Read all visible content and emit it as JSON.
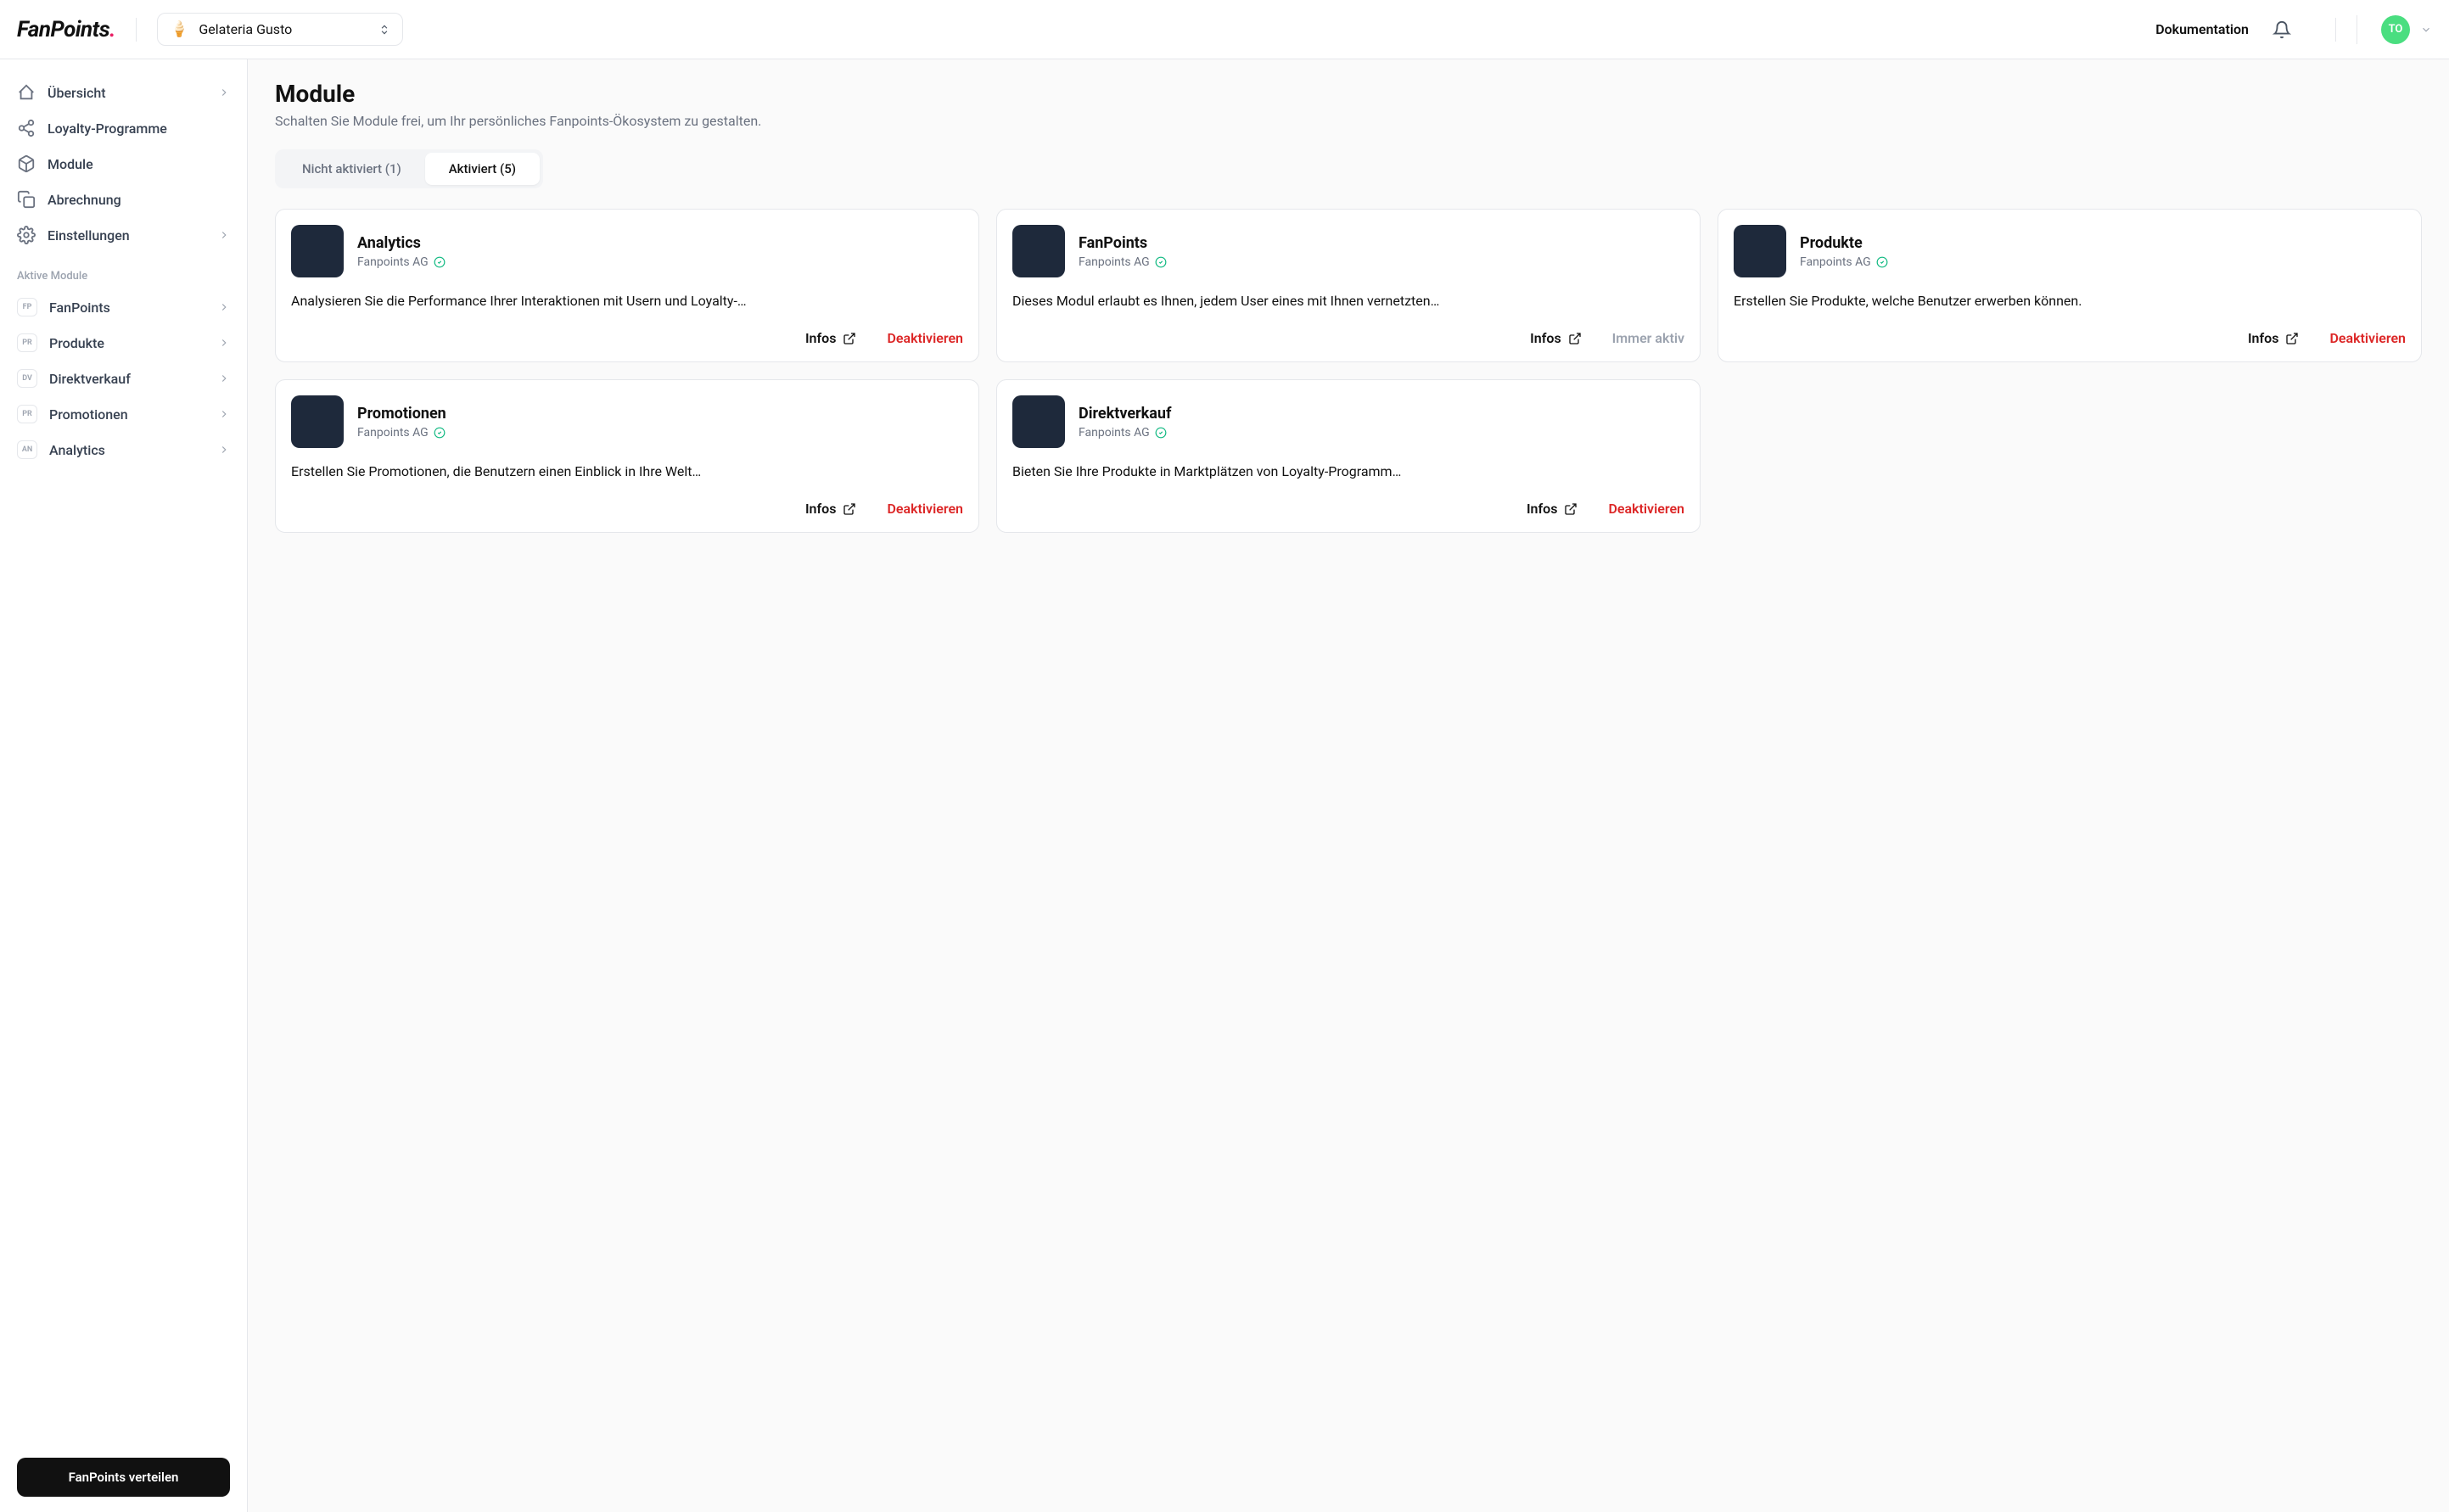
{
  "header": {
    "org_name": "Gelateria Gusto",
    "doc_link": "Dokumentation",
    "avatar_initials": "TO"
  },
  "sidebar": {
    "nav": [
      {
        "label": "Übersicht",
        "has_chevron": true,
        "icon": "home"
      },
      {
        "label": "Loyalty-Programme",
        "has_chevron": false,
        "icon": "share"
      },
      {
        "label": "Module",
        "has_chevron": false,
        "icon": "box"
      },
      {
        "label": "Abrechnung",
        "has_chevron": false,
        "icon": "copy"
      },
      {
        "label": "Einstellungen",
        "has_chevron": true,
        "icon": "gear"
      }
    ],
    "section_label": "Aktive Module",
    "modules": [
      {
        "abbr": "FP",
        "label": "FanPoints"
      },
      {
        "abbr": "PR",
        "label": "Produkte"
      },
      {
        "abbr": "DV",
        "label": "Direktverkauf"
      },
      {
        "abbr": "PR",
        "label": "Promotionen"
      },
      {
        "abbr": "AN",
        "label": "Analytics"
      }
    ],
    "distribute_btn": "FanPoints verteilen"
  },
  "page": {
    "title": "Module",
    "subtitle": "Schalten Sie Module frei, um Ihr persönliches Fanpoints-Ökosystem zu gestalten.",
    "tabs": [
      {
        "label": "Nicht aktiviert (1)",
        "active": false
      },
      {
        "label": "Aktiviert (5)",
        "active": true
      }
    ],
    "info_label": "Infos",
    "deactivate_label": "Deaktivieren",
    "always_active_label": "Immer aktiv",
    "cards": [
      {
        "title": "Analytics",
        "vendor": "Fanpoints AG",
        "desc": "Analysieren Sie die Performance Ihrer Interaktionen mit Usern und Loyalty-…",
        "action": "deactivate"
      },
      {
        "title": "FanPoints",
        "vendor": "Fanpoints AG",
        "desc": "Dieses Modul erlaubt es Ihnen, jedem User eines mit Ihnen vernetzten…",
        "action": "always"
      },
      {
        "title": "Produkte",
        "vendor": "Fanpoints AG",
        "desc": "Erstellen Sie Produkte, welche Benutzer erwerben können.",
        "action": "deactivate"
      },
      {
        "title": "Promotionen",
        "vendor": "Fanpoints AG",
        "desc": "Erstellen Sie Promotionen, die Benutzern einen Einblick in Ihre Welt…",
        "action": "deactivate"
      },
      {
        "title": "Direktverkauf",
        "vendor": "Fanpoints AG",
        "desc": "Bieten Sie Ihre Produkte in Marktplätzen von Loyalty-Programm…",
        "action": "deactivate"
      }
    ]
  }
}
